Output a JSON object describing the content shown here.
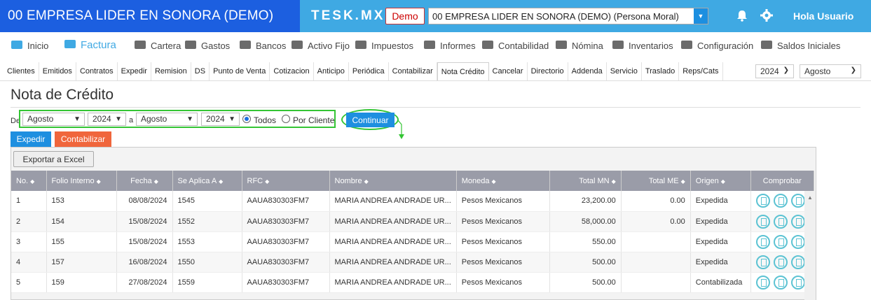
{
  "header": {
    "company_title": "00 EMPRESA LIDER EN SONORA (DEMO)",
    "brand": "TESK.MX",
    "demo_label": "Demo",
    "company_select": "00 EMPRESA LIDER EN SONORA (DEMO) (Persona Moral)",
    "greeting": "Hola Usuario",
    "colors": {
      "left": "#1c5fe0",
      "right": "#3fa9e3"
    }
  },
  "modules": [
    {
      "label": "Inicio",
      "icon": "cloud-icon"
    },
    {
      "label": "Factura",
      "icon": "tag-icon"
    },
    {
      "label": "Cartera",
      "icon": "wallet-icon"
    },
    {
      "label": "Gastos",
      "icon": "cart-icon"
    },
    {
      "label": "Bancos",
      "icon": "safe-icon"
    },
    {
      "label": "Activo Fijo",
      "icon": "house-icon"
    },
    {
      "label": "Impuestos",
      "icon": "briefcase-icon"
    },
    {
      "label": "Informes",
      "icon": "document-icon"
    },
    {
      "label": "Contabilidad",
      "icon": "checklist-icon"
    },
    {
      "label": "Nómina",
      "icon": "card-icon"
    },
    {
      "label": "Inventarios",
      "icon": "box-icon"
    },
    {
      "label": "Configuración",
      "icon": "wrench-icon"
    },
    {
      "label": "Saldos Iniciales",
      "icon": "doc-check-icon"
    }
  ],
  "tabs": [
    "Clientes",
    "Emitidos",
    "Contratos",
    "Expedir",
    "Remision",
    "DS",
    "Punto de Venta",
    "Cotizacion",
    "Anticipo",
    "Periódica",
    "Contabilizar",
    "Nota Crédito",
    "Cancelar",
    "Directorio",
    "Addenda",
    "Servicio",
    "Traslado",
    "Reps/Cats"
  ],
  "active_tab": "Nota Crédito",
  "period": {
    "year": "2024",
    "month": "Agosto"
  },
  "page": {
    "title": "Nota de Crédito"
  },
  "filter": {
    "de_label": "De",
    "a_label": "a",
    "from_month": "Agosto",
    "from_year": "2024",
    "to_month": "Agosto",
    "to_year": "2024",
    "radio_all": "Todos",
    "radio_client": "Por Cliente",
    "continue_label": "Continuar"
  },
  "actions": {
    "expedir": "Expedir",
    "contabilizar": "Contabilizar",
    "export": "Exportar a Excel"
  },
  "table": {
    "headers": [
      "No.",
      "Folio Interno",
      "Fecha",
      "Se Aplica A",
      "RFC",
      "Nombre",
      "Moneda",
      "Total MN",
      "Total ME",
      "Origen",
      "Comprobar"
    ],
    "rows": [
      [
        "1",
        "153",
        "08/08/2024",
        "1545",
        "AAUA830303FM7",
        "MARIA ANDREA ANDRADE UR...",
        "Pesos Mexicanos",
        "23,200.00",
        "0.00",
        "Expedida"
      ],
      [
        "2",
        "154",
        "15/08/2024",
        "1552",
        "AAUA830303FM7",
        "MARIA ANDREA ANDRADE UR...",
        "Pesos Mexicanos",
        "58,000.00",
        "0.00",
        "Expedida"
      ],
      [
        "3",
        "155",
        "15/08/2024",
        "1553",
        "AAUA830303FM7",
        "MARIA ANDREA ANDRADE UR...",
        "Pesos Mexicanos",
        "550.00",
        "",
        "Expedida"
      ],
      [
        "4",
        "157",
        "16/08/2024",
        "1550",
        "AAUA830303FM7",
        "MARIA ANDREA ANDRADE UR...",
        "Pesos Mexicanos",
        "500.00",
        "",
        "Expedida"
      ],
      [
        "5",
        "159",
        "27/08/2024",
        "1559",
        "AAUA830303FM7",
        "MARIA ANDREA ANDRADE UR...",
        "Pesos Mexicanos",
        "500.00",
        "",
        "Contabilizada"
      ]
    ]
  }
}
